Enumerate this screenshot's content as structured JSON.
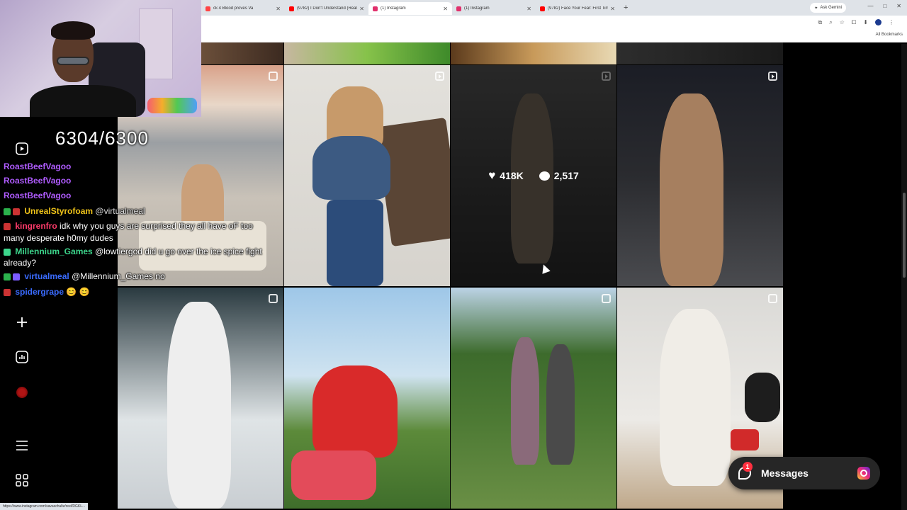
{
  "browser": {
    "tabs": [
      {
        "title": "ck 4 Blood proves Va",
        "favicon_color": "#ff4444"
      },
      {
        "title": "(9782) I Don't Understand (Reali",
        "favicon_color": "#ff0000"
      },
      {
        "title": "(1) Instagram",
        "favicon_color": "#e1306c",
        "active": true
      },
      {
        "title": "(1) Instagram",
        "favicon_color": "#e1306c"
      },
      {
        "title": "(9782) Face Your Fear: First Tim",
        "favicon_color": "#ff0000"
      }
    ],
    "new_tab": "+",
    "gemini_label": "Ask Gemini",
    "bookmarks_label": "All Bookmarks",
    "status_url": "https://www.instagram.com/savaschultz/reel/DGKL...",
    "window_controls": [
      "—",
      "□",
      "✕"
    ]
  },
  "stream": {
    "sub_counter": "6304/6300",
    "chat": [
      {
        "user": "RoastBeefVagoo",
        "user_color": "#b05cff",
        "message": ""
      },
      {
        "user": "RoastBeefVagoo",
        "user_color": "#b05cff",
        "message": ""
      },
      {
        "user": "RoastBeefVagoo",
        "user_color": "#b05cff",
        "message": ""
      },
      {
        "user": "UnrealStyrofoam",
        "user_color": "#f0c419",
        "message": "@virtualmeal"
      },
      {
        "user": "kingrenfro",
        "user_color": "#ff3b6b",
        "message": "idk why you guys are surprised they all have oF too"
      },
      {
        "user": "",
        "user_color": "#ffffff",
        "message": "many desperate h0my dudes"
      },
      {
        "user": "Millennium_Games",
        "user_color": "#3dd68c",
        "message": "@lowtiergod did u go over the ice spice fight"
      },
      {
        "user": "",
        "user_color": "#ffffff",
        "message": "already?"
      },
      {
        "user": "virtualmeal",
        "user_color": "#3a6bff",
        "message": "@Millennium_Games no"
      },
      {
        "user": "spidergrape",
        "user_color": "#3a6bff",
        "message": "😊 😊"
      }
    ]
  },
  "instagram": {
    "hovered_post": {
      "likes": "418K",
      "comments": "2,517"
    },
    "messages": {
      "label": "Messages",
      "unread": "1"
    },
    "nav_icons": [
      "reels-icon",
      "create-icon",
      "dashboard-icon",
      "profile-avatar",
      "menu-icon",
      "apps-icon"
    ]
  }
}
